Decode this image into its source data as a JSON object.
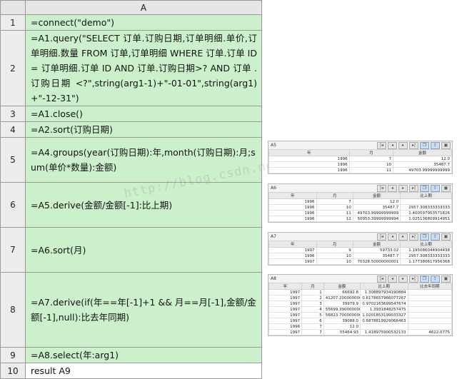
{
  "grid": {
    "column_header": "A",
    "rows": [
      {
        "num": "1",
        "height": 21,
        "code": "=connect(\"demo\")"
      },
      {
        "num": "2",
        "height": 106,
        "code": "=A1.query(\"SELECT 订单.订购日期,订单明细.单价,订单明细.数量 FROM 订单,订单明细 WHERE 订单.订单 ID = 订单明细.订单 ID AND 订单.订购日期>? AND 订单 . 订购日期 <?\",string(arg1-1)+\"-01-01\",string(arg1)+\"-12-31\")"
      },
      {
        "num": "3",
        "height": 21,
        "code": "=A1.close()"
      },
      {
        "num": "4",
        "height": 21,
        "code": "=A2.sort(订购日期)"
      },
      {
        "num": "5",
        "height": 63,
        "code": "=A4.groups(year(订购日期):年,month(订购日期):月;sum(单价*数量):金额)"
      },
      {
        "num": "6",
        "height": 63,
        "code": "=A5.derive(金额/金额[-1]:比上期)"
      },
      {
        "num": "7",
        "height": 63,
        "code": "=A6.sort(月)"
      },
      {
        "num": "8",
        "height": 105,
        "code": "=A7.derive(if(年==年[-1]+1 && 月==月[-1],金额/金额[-1],null):比去年同期)"
      },
      {
        "num": "9",
        "height": 21,
        "code": "=A8.select(年:arg1)"
      },
      {
        "num": "10",
        "height": 21,
        "code": "result A9"
      }
    ]
  },
  "watermark": "http://blog.csdn.net/u012388487",
  "panels": [
    {
      "title": "A5",
      "columns": [
        "年",
        "月",
        "金额"
      ],
      "rows": [
        [
          "1996",
          "7",
          "12.0"
        ],
        [
          "1996",
          "10",
          "35487.7"
        ],
        [
          "1996",
          "11",
          "49703.99999999999"
        ]
      ]
    },
    {
      "title": "A6",
      "columns": [
        "年",
        "月",
        "金额",
        "比上期"
      ],
      "rows": [
        [
          "1996",
          "7",
          "12.0",
          ""
        ],
        [
          "1996",
          "10",
          "35487.7",
          "2957.308333333333"
        ],
        [
          "1996",
          "11",
          "49703.99999999999",
          "1.400597953571826"
        ],
        [
          "1996",
          "12",
          "50953.39999999994",
          "1.025136809914951"
        ]
      ]
    },
    {
      "title": "A7",
      "columns": [
        "年",
        "月",
        "金额",
        "比上期"
      ],
      "rows": [
        [
          "1997",
          "9",
          "59733.02",
          "1.195086044904438"
        ],
        [
          "1996",
          "10",
          "35487.7",
          "2957.308333333333"
        ],
        [
          "1997",
          "10",
          "70328.50000000001",
          "1.177380617956368"
        ]
      ]
    },
    {
      "title": "A8",
      "columns": [
        "年",
        "月",
        "金额",
        "比上期",
        "比去年同期"
      ],
      "rows": [
        [
          "1997",
          "1",
          "66692.8",
          "1.308897934190884",
          ""
        ],
        [
          "1997",
          "2",
          "41207.20000000006",
          "0.6178657966077267",
          ""
        ],
        [
          "1997",
          "3",
          "39979.9",
          "0.9702163699547674",
          ""
        ],
        [
          "1997",
          "4",
          "55699.39000000001",
          "1.3931848257475",
          ""
        ],
        [
          "1997",
          "5",
          "56823.70000000001",
          "1.0201853199033327",
          ""
        ],
        [
          "1997",
          "6",
          "39088.0",
          "0.6878819929066463",
          ""
        ],
        [
          "1996",
          "7",
          "12.0",
          "",
          ""
        ],
        [
          "1997",
          "7",
          "55464.93",
          "1.418975900532133",
          "4622.0775"
        ]
      ]
    }
  ]
}
